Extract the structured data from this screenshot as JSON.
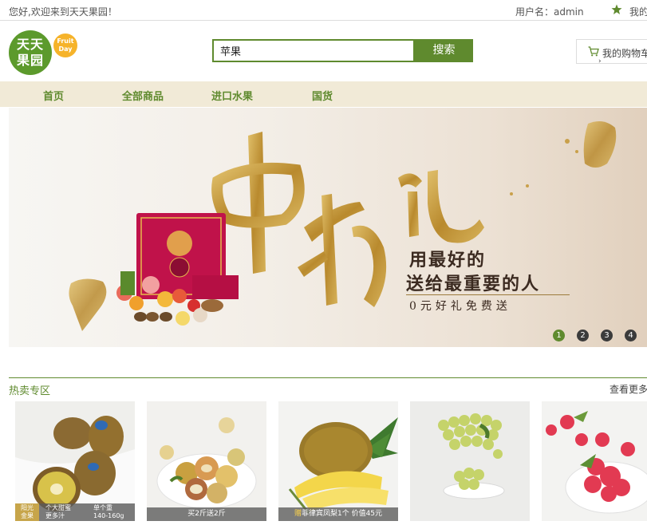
{
  "topbar": {
    "welcome": "您好,欢迎来到天天果园！",
    "user": "用户名：admin",
    "mine": "我的"
  },
  "logo": {
    "line1": "天天",
    "line2": "果园",
    "badge_line1": "Fruit",
    "badge_line2": "Day"
  },
  "search": {
    "value": "苹果",
    "button": "搜索"
  },
  "cart": {
    "label": "我的购物车",
    "chevron": "›"
  },
  "nav": {
    "items": [
      "首页",
      "全部商品",
      "进口水果",
      "国货"
    ]
  },
  "banner": {
    "line1": "用最好的",
    "line2": "送给最重要的人",
    "line3": "0元好礼免费送",
    "dots": [
      "1",
      "2",
      "3",
      "4"
    ],
    "active_dot": 0
  },
  "hot": {
    "title": "热卖专区",
    "more": "查看更多"
  },
  "products": [
    {
      "name": "kiwi",
      "strip_gold": "阳光\n金果",
      "strip_mid": "个大甜蜜\n更多汁",
      "strip_right": "单个重\n140-160g"
    },
    {
      "name": "peach",
      "strip": "买2斤送2斤"
    },
    {
      "name": "pineapple",
      "strip_hl": "赠",
      "strip": "菲律宾凤梨1个 价值45元"
    },
    {
      "name": "grapes"
    },
    {
      "name": "raspberry"
    }
  ],
  "colors": {
    "brand_green": "#5f8a2e",
    "nav_bg": "#f1ead7",
    "gold": "#c7a54a"
  }
}
